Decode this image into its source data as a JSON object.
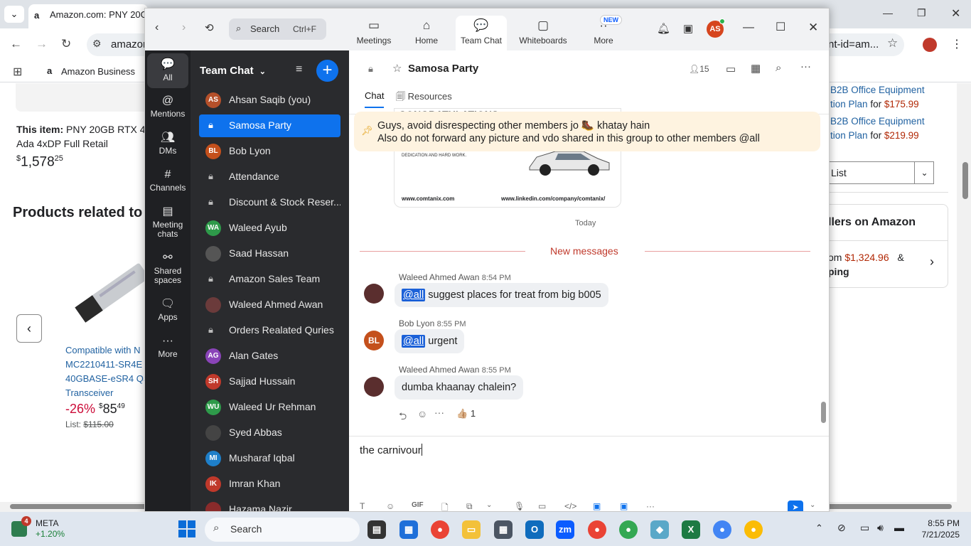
{
  "chrome": {
    "tab_title": "Amazon.com: PNY 20GB",
    "url_partial": "amazon",
    "url_tail": "nt-id=am...",
    "bookmark": "Amazon Business"
  },
  "amazon": {
    "this_item_label": "This item:",
    "this_item_title_1": "PNY 20GB RTX 40",
    "this_item_title_2": "Ada 4xDP Full Retail",
    "this_item_price_currency": "$",
    "this_item_price_main": "1,578",
    "this_item_price_cents": "25",
    "related_heading": "Products related to",
    "product_line1": "Compatible with N",
    "product_line2": "MC2210411-SR4E",
    "product_line3": "40GBASE-eSR4 QS",
    "product_line4": "Transceiver",
    "product_discount": "-26%",
    "product_price_currency": "$",
    "product_price_main": "85",
    "product_price_cents": "49",
    "product_list_label": "List:",
    "product_list_price": "$115.00",
    "plan1_line1": "B2B Office Equipment",
    "plan1_line2": "tion Plan",
    "plan1_for": "for",
    "plan1_price": "$175.99",
    "plan2_line1": "B2B Office Equipment",
    "plan2_line2": "tion Plan",
    "plan2_for": "for",
    "plan2_price": "$219.99",
    "list_select": "List",
    "sellers_heading": "llers on Amazon",
    "sellers_from": "om",
    "sellers_price": "$1,324.96",
    "sellers_amp": "&",
    "sellers_ship": "ping"
  },
  "zoom": {
    "search_placeholder": "Search",
    "search_shortcut": "Ctrl+F",
    "nav": [
      {
        "label": "Meetings",
        "icon": "video-icon"
      },
      {
        "label": "Home",
        "icon": "home-icon"
      },
      {
        "label": "Team Chat",
        "icon": "chat-icon"
      },
      {
        "label": "Whiteboards",
        "icon": "whiteboard-icon"
      },
      {
        "label": "More",
        "icon": "more-icon"
      }
    ],
    "new_badge": "NEW",
    "profile_initials": "AS",
    "rail": [
      {
        "label": "All"
      },
      {
        "label": "Mentions"
      },
      {
        "label": "DMs"
      },
      {
        "label": "Channels"
      },
      {
        "label": "Meeting chats"
      },
      {
        "label": "Shared spaces"
      },
      {
        "label": "Apps"
      },
      {
        "label": "More"
      }
    ],
    "list_title": "Team Chat",
    "chats": [
      {
        "name": "Ahsan Saqib (you)",
        "initials": "AS",
        "color": "#b5502a"
      },
      {
        "name": "Samosa Party",
        "initials": "",
        "color": ""
      },
      {
        "name": "Bob Lyon",
        "initials": "BL",
        "color": "#c4501c"
      },
      {
        "name": "Attendance",
        "initials": "",
        "color": ""
      },
      {
        "name": "Discount & Stock Reser...",
        "initials": "",
        "color": ""
      },
      {
        "name": "Waleed Ayub",
        "initials": "WA",
        "color": "#2e9a4a"
      },
      {
        "name": "Saad Hassan",
        "initials": "",
        "color": "#555"
      },
      {
        "name": "Amazon Sales Team",
        "initials": "",
        "color": ""
      },
      {
        "name": "Waleed Ahmed Awan",
        "initials": "",
        "color": "#6b3b3b"
      },
      {
        "name": "Orders Realated Quries",
        "initials": "",
        "color": ""
      },
      {
        "name": "Alan Gates",
        "initials": "AG",
        "color": "#8a44b8"
      },
      {
        "name": "Sajjad Hussain",
        "initials": "SH",
        "color": "#c0392b"
      },
      {
        "name": "Waleed Ur Rehman",
        "initials": "WU",
        "color": "#2e9a4a"
      },
      {
        "name": "Syed Abbas",
        "initials": "",
        "color": "#444"
      },
      {
        "name": "Musharaf Iqbal",
        "initials": "MI",
        "color": "#1e7fc9"
      },
      {
        "name": "Imran Khan",
        "initials": "IK",
        "color": "#c0392b"
      },
      {
        "name": "Hazama Nazir",
        "initials": "",
        "color": "#8a2b2b"
      }
    ],
    "channel": {
      "name": "Samosa Party",
      "member_count": "15",
      "tab_chat": "Chat",
      "tab_resources": "Resources",
      "image_banner": "CONGRATULATIONS",
      "image_caption": "DEDICATION AND HARD WORK.",
      "image_site": "www.comtanix.com",
      "image_linkedin": "www.linkedin.com/company/comtanix/",
      "pinned_line1": "Guys, avoid disrespecting other members jo 🥾 khatay hain",
      "pinned_line2": "Also do not forward any picture and vdo shared in this group to other members @all",
      "date_label": "Today",
      "new_messages": "New messages",
      "messages": [
        {
          "sender": "Waleed Ahmed Awan",
          "time": "8:54 PM",
          "mention": "@all",
          "text": " suggest places for treat from big b005"
        },
        {
          "sender": "Bob Lyon",
          "time": "8:55 PM",
          "mention": "@all",
          "text": " urgent",
          "initials": "BL"
        },
        {
          "sender": "Waleed Ahmed Awan",
          "time": "8:55 PM",
          "mention": "",
          "text": "dumba khaanay chalein?"
        }
      ],
      "reaction_emoji": "👍🏼",
      "reaction_count": "1",
      "composer_text": "the carnivour"
    }
  },
  "taskbar": {
    "stock_name": "META",
    "stock_change": "+1.20%",
    "stock_badge": "4",
    "search": "Search",
    "time": "8:55 PM",
    "date": "7/21/2025"
  }
}
